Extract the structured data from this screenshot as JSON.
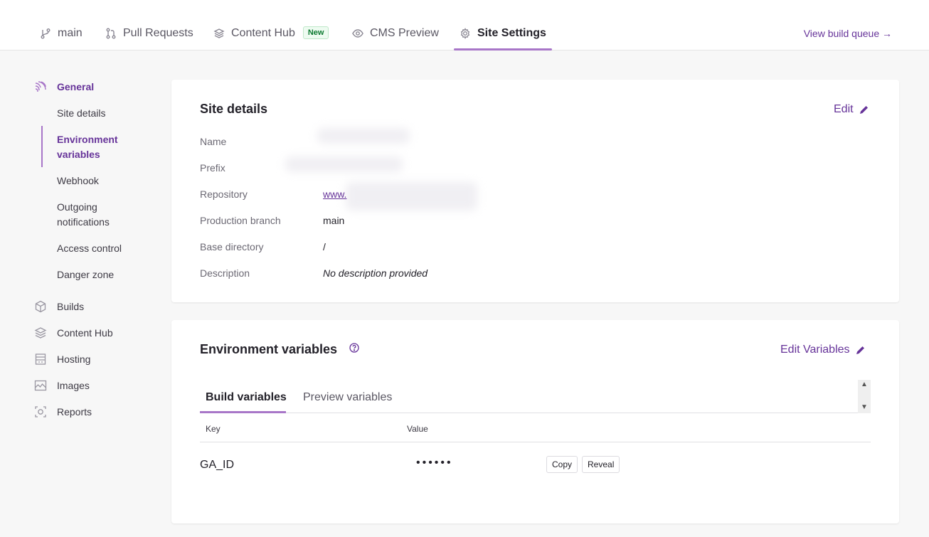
{
  "topnav": {
    "tabs": [
      {
        "label": "main",
        "icon": "branch-icon"
      },
      {
        "label": "Pull Requests",
        "icon": "pull-request-icon"
      },
      {
        "label": "Content Hub",
        "icon": "layers-icon",
        "badge": "New"
      },
      {
        "label": "CMS Preview",
        "icon": "eye-icon"
      },
      {
        "label": "Site Settings",
        "icon": "gear-icon",
        "active": true
      }
    ],
    "view_queue": "View build queue →"
  },
  "sidebar": {
    "general": "General",
    "sub_items": [
      "Site details",
      "Environment variables",
      "Webhook",
      "Outgoing notifications",
      "Access control",
      "Danger zone"
    ],
    "active_sub": "Environment variables",
    "items": [
      {
        "label": "Builds",
        "icon": "cube-icon"
      },
      {
        "label": "Content Hub",
        "icon": "layers-icon"
      },
      {
        "label": "Hosting",
        "icon": "building-icon"
      },
      {
        "label": "Images",
        "icon": "image-icon"
      },
      {
        "label": "Reports",
        "icon": "report-icon"
      }
    ]
  },
  "site_details": {
    "title": "Site details",
    "edit": "Edit",
    "rows": [
      {
        "label": "Name",
        "value": ""
      },
      {
        "label": "Prefix",
        "value": ""
      },
      {
        "label": "Repository",
        "value": "www."
      },
      {
        "label": "Production branch",
        "value": "main"
      },
      {
        "label": "Base directory",
        "value": "/"
      },
      {
        "label": "Description",
        "value": "No description provided"
      }
    ]
  },
  "env_vars": {
    "title": "Environment variables",
    "edit": "Edit Variables",
    "tabs": [
      "Build variables",
      "Preview variables"
    ],
    "columns": [
      "Key",
      "Value"
    ],
    "rows": [
      {
        "key": "GA_ID",
        "value": "••••••",
        "copy": "Copy",
        "reveal": "Reveal"
      }
    ]
  },
  "colors": {
    "accent": "#663399",
    "accent_light": "#a876c8",
    "badge_green": "#0d7a31"
  }
}
